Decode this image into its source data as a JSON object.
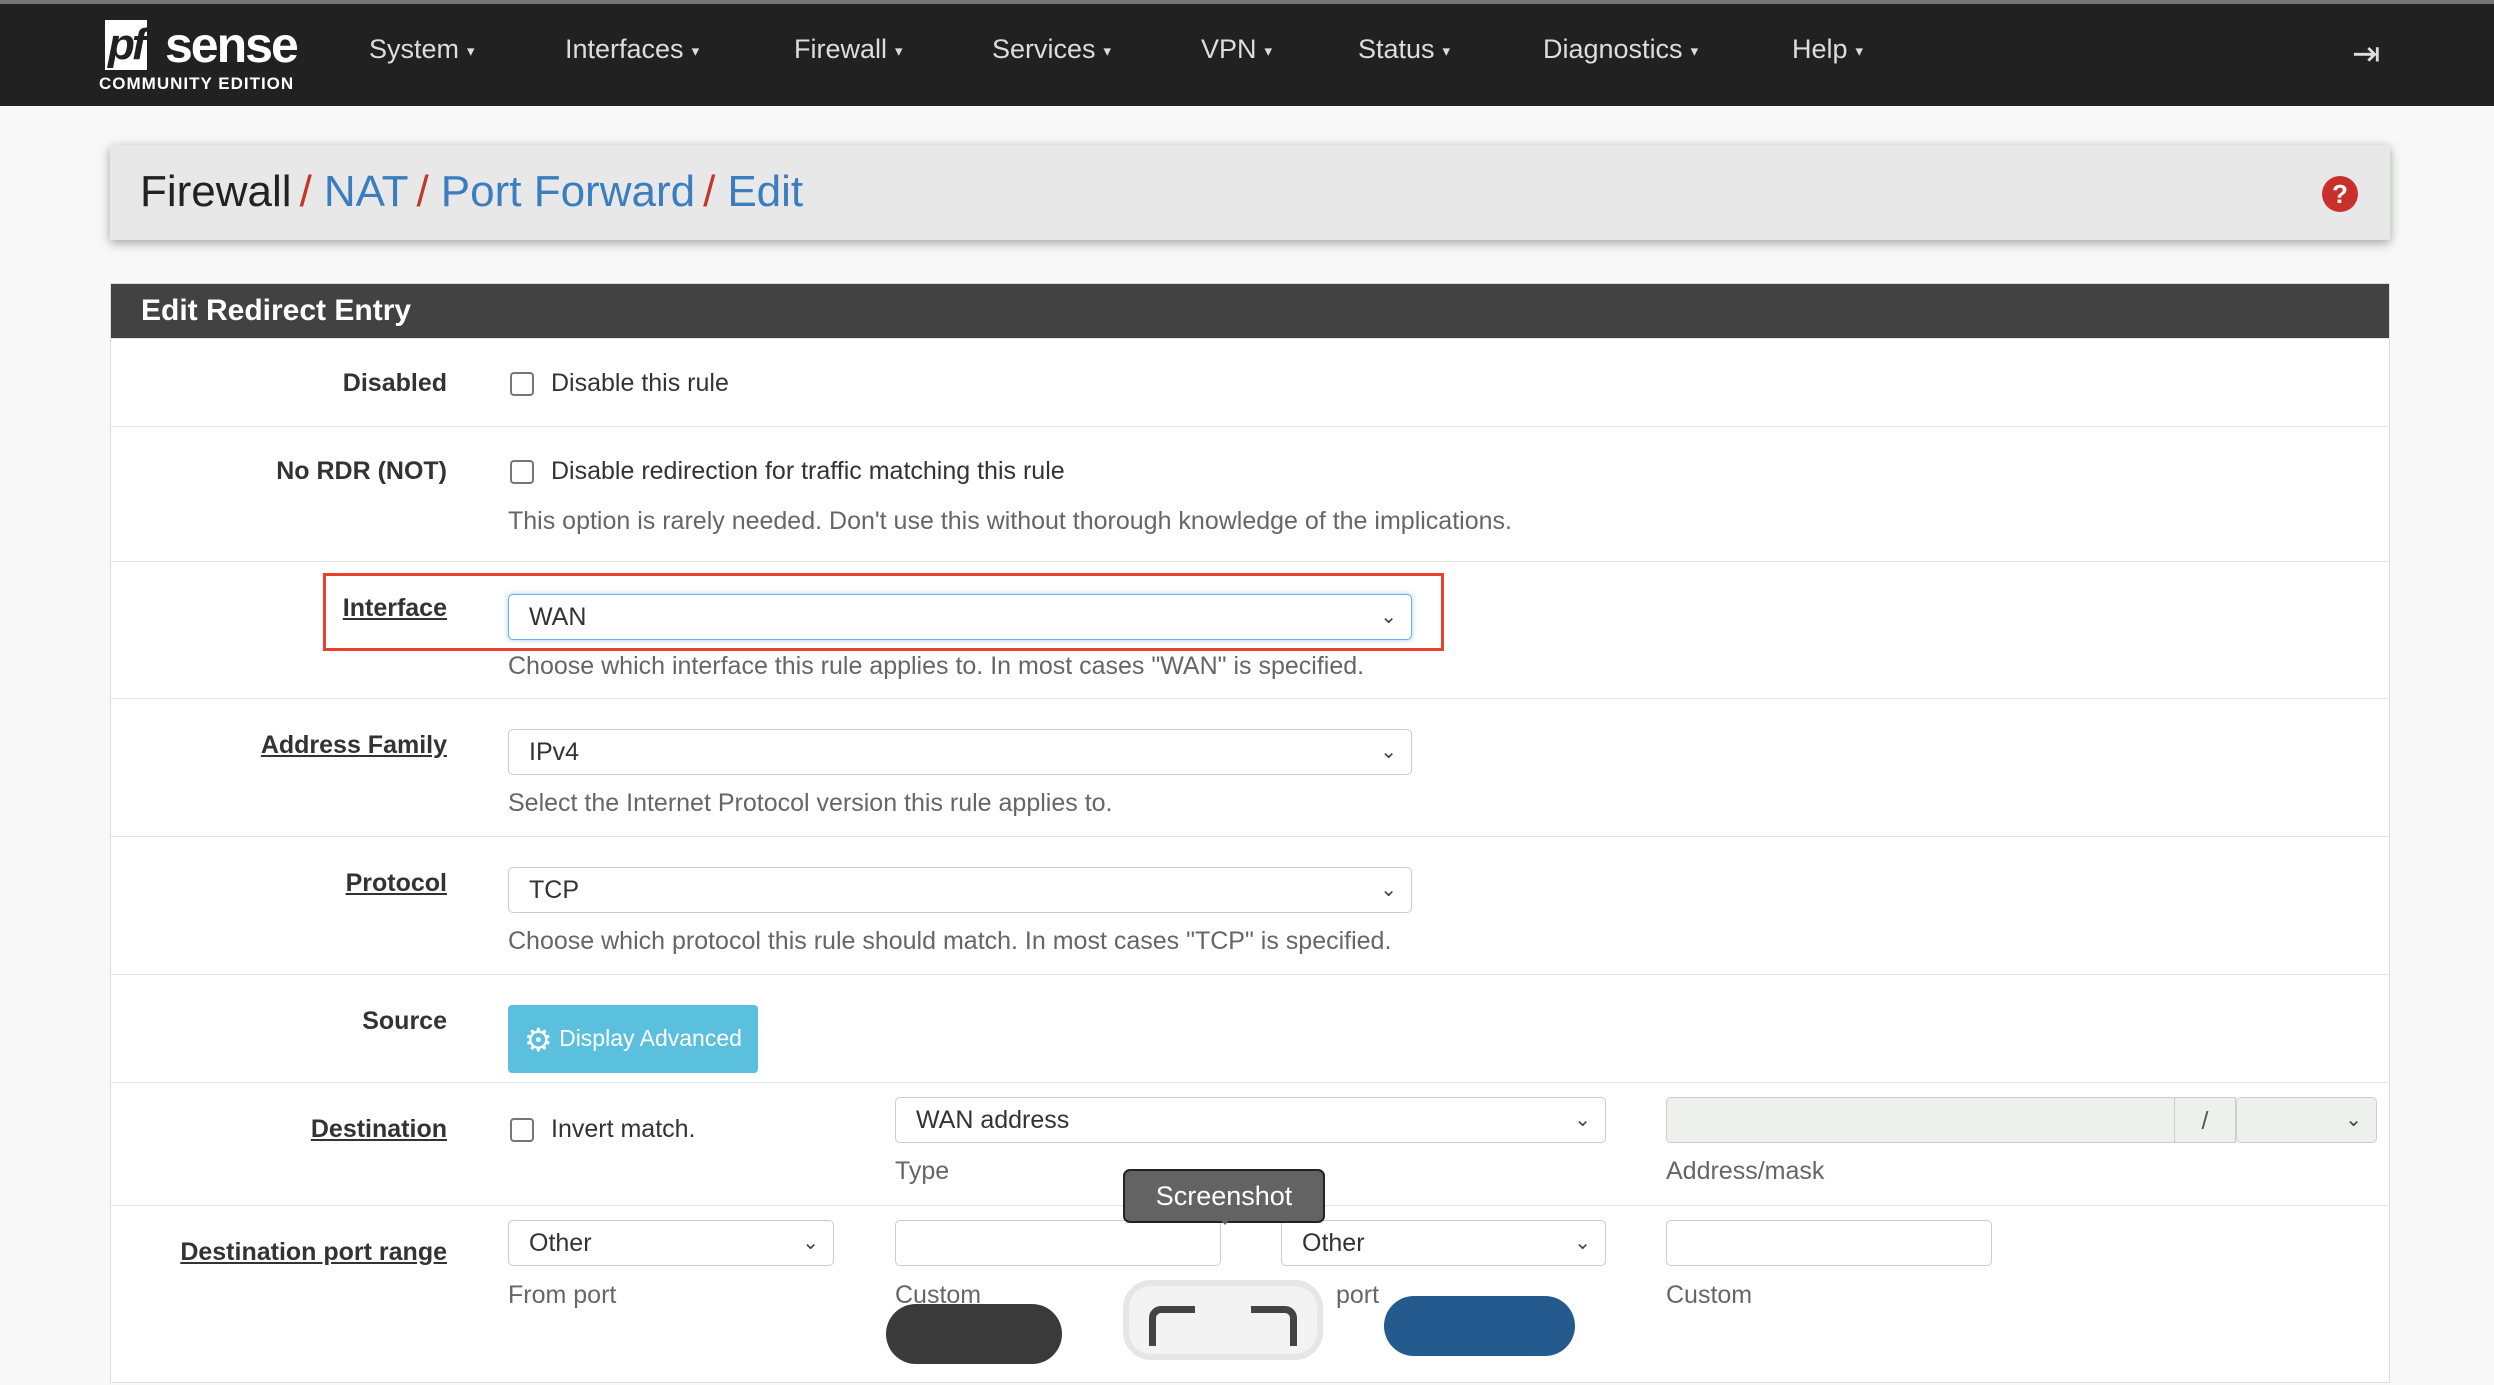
{
  "navbar": {
    "logo_pf": "pf",
    "logo_sense": "sense",
    "logo_sub": "COMMUNITY EDITION",
    "items": [
      {
        "label": "System"
      },
      {
        "label": "Interfaces"
      },
      {
        "label": "Firewall"
      },
      {
        "label": "Services"
      },
      {
        "label": "VPN"
      },
      {
        "label": "Status"
      },
      {
        "label": "Diagnostics"
      },
      {
        "label": "Help"
      }
    ],
    "caret": "▾",
    "logout_icon": "⇥"
  },
  "breadcrumb": {
    "items": [
      "Firewall",
      "NAT",
      "Port Forward",
      "Edit"
    ],
    "sep": "/",
    "help_icon": "?"
  },
  "panel": {
    "title": "Edit Redirect Entry"
  },
  "form": {
    "disabled": {
      "label": "Disabled",
      "checkbox_label": "Disable this rule"
    },
    "nordr": {
      "label": "No RDR (NOT)",
      "checkbox_label": "Disable redirection for traffic matching this rule",
      "hint": "This option is rarely needed. Don't use this without thorough knowledge of the implications."
    },
    "interface": {
      "label": "Interface",
      "value": "WAN",
      "hint": "Choose which interface this rule applies to. In most cases \"WAN\" is specified."
    },
    "family": {
      "label": "Address Family",
      "value": "IPv4",
      "hint": "Select the Internet Protocol version this rule applies to."
    },
    "protocol": {
      "label": "Protocol",
      "value": "TCP",
      "hint": "Choose which protocol this rule should match. In most cases \"TCP\" is specified."
    },
    "source": {
      "label": "Source",
      "button": "Display Advanced"
    },
    "destination": {
      "label": "Destination",
      "invert": "Invert match.",
      "type_value": "WAN address",
      "type_label": "Type",
      "addr_label": "Address/mask",
      "slash": "/"
    },
    "dport": {
      "label": "Destination port range",
      "from_value": "Other",
      "from_label": "From port",
      "custom1": "Custom",
      "to_value": "Other",
      "to_label": "port",
      "custom2": "Custom"
    }
  },
  "tooltip": "Screenshot"
}
